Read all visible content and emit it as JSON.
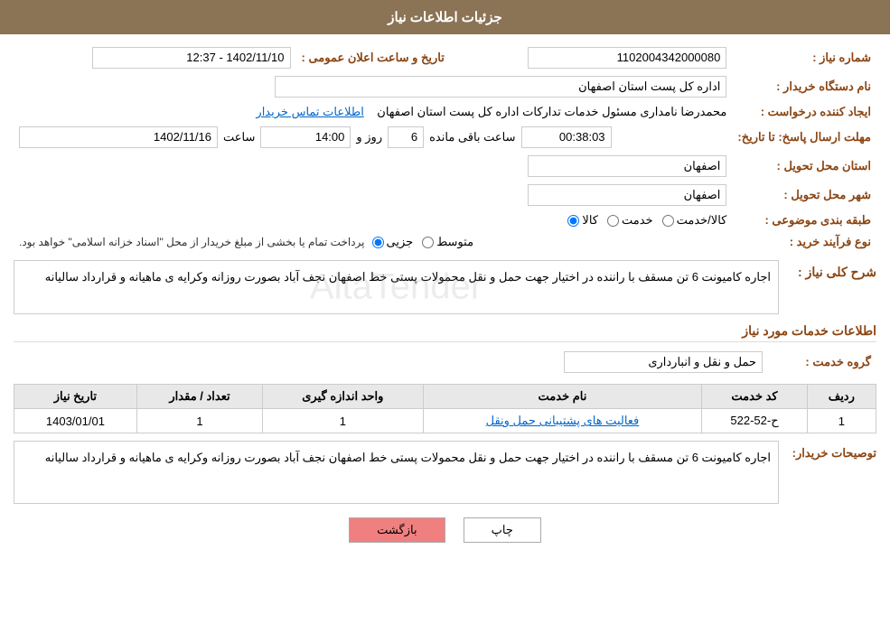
{
  "header": {
    "title": "جزئیات اطلاعات نیاز"
  },
  "fields": {
    "need_number_label": "شماره نیاز :",
    "need_number_value": "1102004342000080",
    "buyer_org_label": "نام دستگاه خریدار :",
    "buyer_org_value": "اداره کل پست استان اصفهان",
    "creator_label": "ایجاد کننده درخواست :",
    "creator_value": "محمدرضا نامداری مسئول خدمات تداركات اداره كل پست استان اصفهان",
    "creator_link": "اطلاعات تماس خریدار",
    "deadline_label": "مهلت ارسال پاسخ: تا تاریخ:",
    "deadline_date": "1402/11/16",
    "deadline_time_label": "ساعت",
    "deadline_time": "14:00",
    "deadline_day_label": "روز و",
    "deadline_days": "6",
    "deadline_remain_label": "ساعت باقی مانده",
    "deadline_remain": "00:38:03",
    "province_label": "استان محل تحویل :",
    "province_value": "اصفهان",
    "city_label": "شهر محل تحویل :",
    "city_value": "اصفهان",
    "category_label": "طبقه بندی موضوعی :",
    "category_options": [
      "کالا",
      "خدمت",
      "کالا/خدمت"
    ],
    "category_selected": "کالا",
    "process_label": "نوع فرآیند خرید :",
    "process_options": [
      "جزیی",
      "متوسط"
    ],
    "process_note": "پرداخت تمام یا بخشی از مبلغ خریدار از محل \"اسناد خزانه اسلامی\" خواهد بود.",
    "announce_label": "تاریخ و ساعت اعلان عمومی :",
    "announce_value": "1402/11/10 - 12:37"
  },
  "description_section": {
    "title": "شرح کلی نیاز :",
    "text": "اجاره کامیونت 6 تن مسقف با راننده در اختیار جهت حمل و نقل محمولات پستی خط  اصفهان نجف آباد  بصورت روزانه وکرایه ی ماهیانه و قرارداد سالیانه"
  },
  "service_info": {
    "title": "اطلاعات خدمات مورد نیاز",
    "group_label": "گروه خدمت :",
    "group_value": "حمل و نقل و انبارداری",
    "table": {
      "headers": [
        "ردیف",
        "کد خدمت",
        "نام خدمت",
        "واحد اندازه گیری",
        "تعداد / مقدار",
        "تاریخ نیاز"
      ],
      "rows": [
        {
          "row": "1",
          "code": "ح-52-522",
          "name": "فعالیت های پشتیبانی حمل ونقل",
          "unit": "1",
          "quantity": "1",
          "date": "1403/01/01"
        }
      ]
    }
  },
  "buyer_description": {
    "label": "توصیحات خریدار:",
    "text": "اجاره کامیونت 6 تن مسقف با راننده در اختیار جهت حمل و نقل محمولات پستی خط  اصفهان نجف آباد  بصورت روزانه وکرایه ی ماهیانه و قرارداد سالیانه"
  },
  "buttons": {
    "print": "چاپ",
    "back": "بازگشت"
  }
}
